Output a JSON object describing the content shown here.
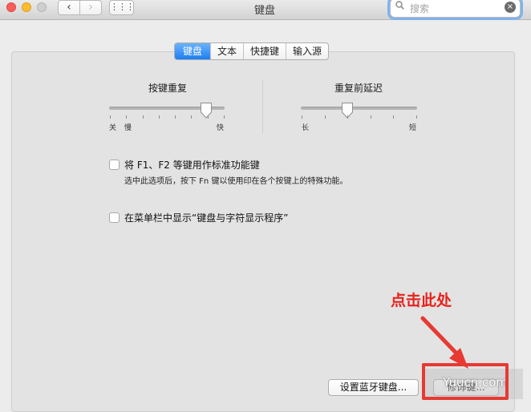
{
  "window": {
    "title": "键盘"
  },
  "titlebar": {
    "back_icon": "‹",
    "forward_icon": "›",
    "grid_icon": "⋮⋮⋮"
  },
  "search": {
    "placeholder": "搜索",
    "icon": "search-icon",
    "clear_icon": "×"
  },
  "tabs": [
    {
      "label": "键盘",
      "active": true
    },
    {
      "label": "文本",
      "active": false
    },
    {
      "label": "快捷键",
      "active": false
    },
    {
      "label": "输入源",
      "active": false
    }
  ],
  "key_repeat": {
    "title": "按键重复",
    "label_off": "关",
    "label_slow": "慢",
    "label_fast": "快",
    "tick_count": 8,
    "value_fraction": 0.84
  },
  "repeat_delay": {
    "title": "重复前延迟",
    "label_long": "长",
    "label_short": "短",
    "tick_count": 6,
    "value_fraction": 0.4
  },
  "fn_option": {
    "label": "将 F1、F2 等键用作标准功能键",
    "description": "选中此选项后，按下 Fn 键以使用印在各个按键上的特殊功能。",
    "checked": false
  },
  "menubar_option": {
    "label": "在菜单栏中显示“键盘与字符显示程序”",
    "checked": false
  },
  "buttons": {
    "bluetooth": "设置蓝牙键盘...",
    "modifier": "修饰键..."
  },
  "annotation": {
    "text": "点击此处",
    "color": "#e8211b"
  },
  "watermark": {
    "text": "Yuucn.com"
  }
}
